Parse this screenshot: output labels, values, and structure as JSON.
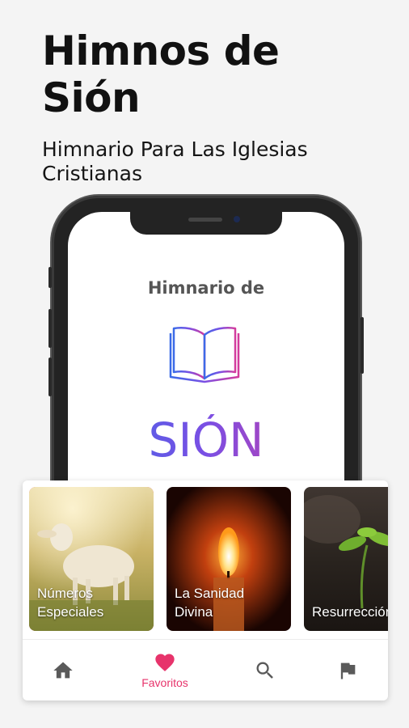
{
  "headline": {
    "title_line1": "Himnos de",
    "title_line2": "Sión",
    "subtitle_line1": "Himnario Para Las Iglesias",
    "subtitle_line2": "Cristianas"
  },
  "phone_screen": {
    "pre_title": "Himnario de",
    "title": "SIÓN",
    "logo_icon": "open-book-icon"
  },
  "categories": [
    {
      "label_line1": "Números",
      "label_line2": "Especiales",
      "image": "lamb-in-field",
      "selected": true
    },
    {
      "label_line1": "La Sanidad",
      "label_line2": "Divina",
      "image": "candle-flame",
      "selected": false
    },
    {
      "label_line1": "",
      "label_line2": "Resurrección",
      "image": "plant-sprout",
      "selected": false
    }
  ],
  "bottom_nav": {
    "items": [
      {
        "icon": "home-icon",
        "label": ""
      },
      {
        "icon": "heart-icon",
        "label": "Favoritos",
        "active": true
      },
      {
        "icon": "search-icon",
        "label": ""
      },
      {
        "icon": "flag-icon",
        "label": ""
      }
    ]
  },
  "colors": {
    "accent": "#e7336b",
    "nav_icon": "#5a5a5a",
    "background": "#f4f4f4",
    "title_gradient": [
      "#3b6be8",
      "#7a4fe4",
      "#d43b9c"
    ]
  }
}
